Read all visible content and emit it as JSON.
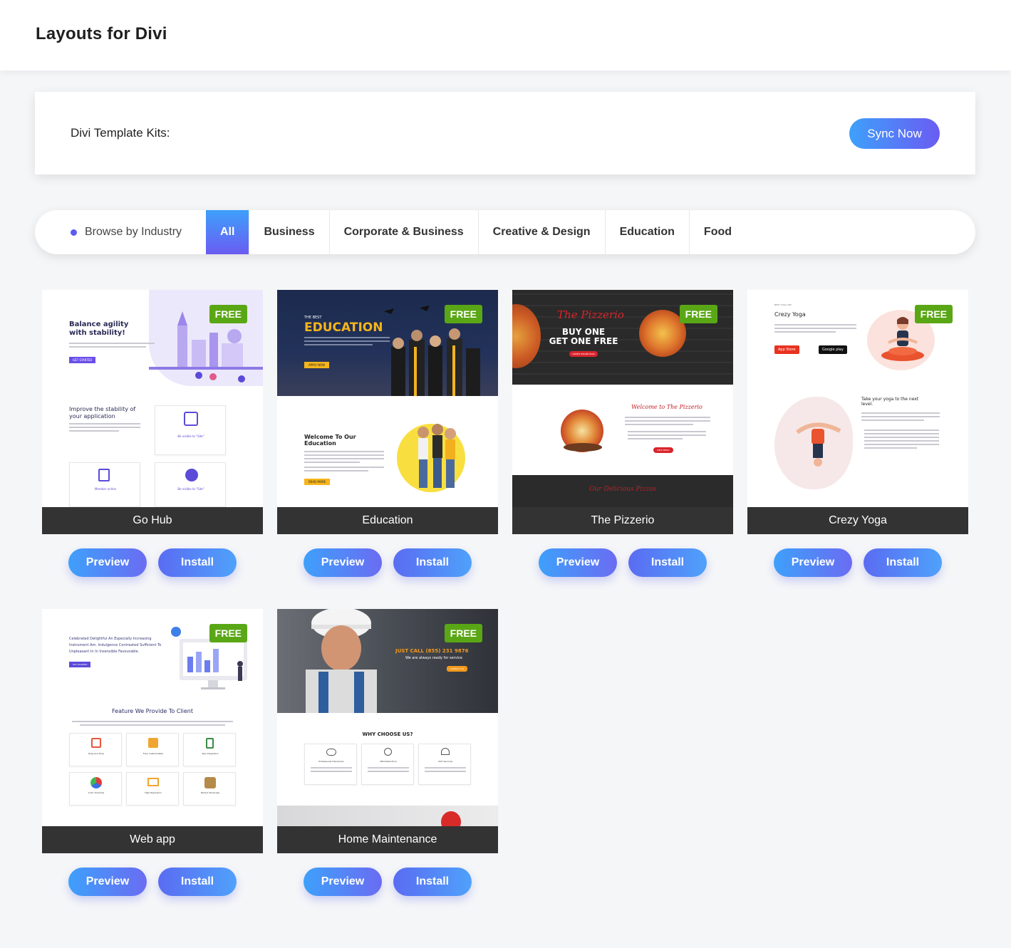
{
  "header": {
    "title": "Layouts for Divi"
  },
  "sync": {
    "label": "Divi Template Kits:",
    "button": "Sync Now"
  },
  "filter": {
    "browse_label": "Browse by Industry",
    "tabs": [
      "All",
      "Business",
      "Corporate & Business",
      "Creative & Design",
      "Education",
      "Food"
    ],
    "active": "All"
  },
  "cards": [
    {
      "name": "Go Hub",
      "badge": "FREE",
      "preview": "Preview",
      "install": "Install",
      "thumb": {
        "headline": "Balance agility with stability!",
        "section": "Improve the stability of your application",
        "f1": "Be visible to \"Site\"",
        "f2": "Member online",
        "f3": "Be visible to \"Site\"",
        "cta": "GET STARTED"
      }
    },
    {
      "name": "Education",
      "badge": "FREE",
      "preview": "Preview",
      "install": "Install",
      "thumb": {
        "kicker": "THE BEST",
        "headline": "EDUCATION",
        "cta": "APPLY NOW",
        "section": "Welcome To Our Education",
        "cta2": "READ MORE"
      }
    },
    {
      "name": "The Pizzerio",
      "badge": "FREE",
      "preview": "Preview",
      "install": "Install",
      "thumb": {
        "logo": "The Pizzerio",
        "line1": "BUY ONE",
        "line2": "GET ONE FREE",
        "cta": "ORDER ONLINE NOW",
        "welcome": "Welcome to The Pizzerio",
        "cta2": "VIEW MENU",
        "footer": "Our Delicious Pizzas"
      }
    },
    {
      "name": "Crezy Yoga",
      "badge": "FREE",
      "preview": "Preview",
      "install": "Install",
      "thumb": {
        "kicker": "BEST YOGA APP",
        "title": "Crezy Yoga",
        "store1": "App Store",
        "store2": "Google play",
        "section": "Take your yoga to the next level."
      }
    },
    {
      "name": "Web app",
      "badge": "FREE",
      "preview": "Preview",
      "install": "Install",
      "thumb": {
        "headline": "Celebrated Delightful An Especially Increasing Instrument Am. Indulgence Contrasted Sufficient To Unpleasant In In Insensible Favourable.",
        "cta": "GET STARTED",
        "section": "Feature We Provide To Client",
        "features": [
          "Drag and Drop",
          "Fully Customizable",
          "App Integration",
          "Color Schemes",
          "High Resolution",
          "Perfect Showcase"
        ]
      }
    },
    {
      "name": "Home Maintenance",
      "badge": "FREE",
      "preview": "Preview",
      "install": "Install",
      "thumb": {
        "call": "JUST CALL (855) 231 9876",
        "sub": "We are always ready for service",
        "cta": "CONTACT US",
        "section": "WHY CHOOSE US?",
        "features": [
          "Professional Handyman",
          "Affordable Price",
          "24/7 Services"
        ]
      }
    }
  ],
  "colors": {
    "accent_from": "#3ea0fb",
    "accent_to": "#6a5cf2",
    "badge": "#5aa716",
    "caption_bg": "#333333"
  }
}
